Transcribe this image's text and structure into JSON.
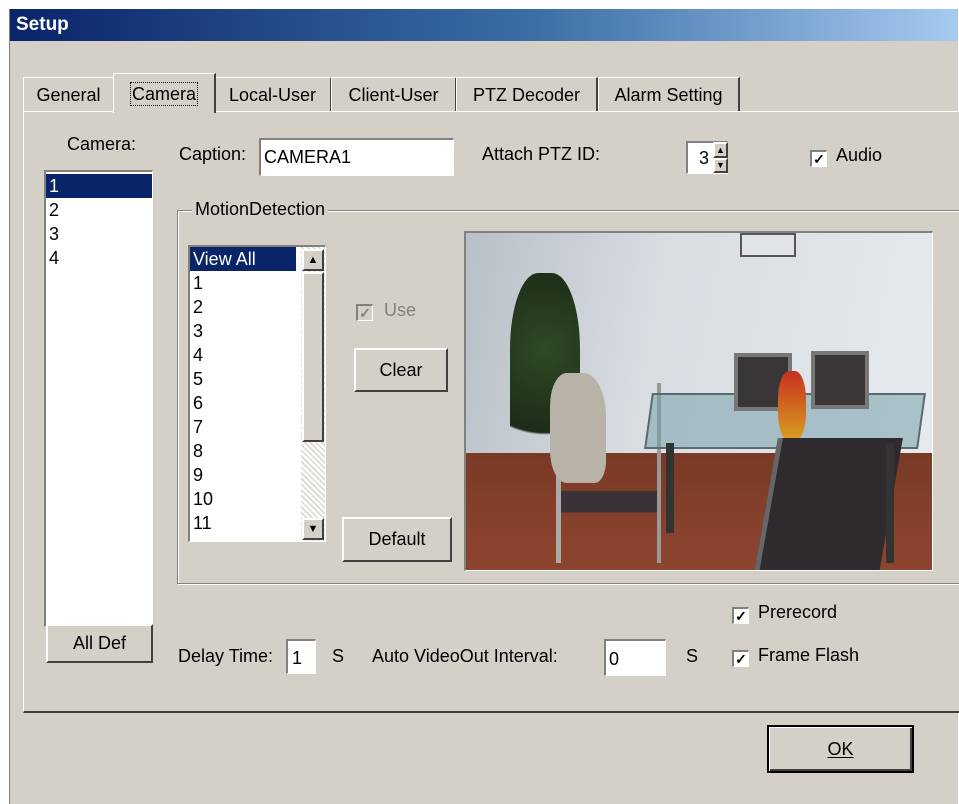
{
  "window": {
    "title": "Setup"
  },
  "tabs": [
    "General",
    "Camera",
    "Local-User",
    "Client-User",
    "PTZ Decoder",
    "Alarm Setting"
  ],
  "camera_list": {
    "label": "Camera:",
    "items": [
      "1",
      "2",
      "3",
      "4"
    ],
    "selected": "1"
  },
  "caption": {
    "label": "Caption:",
    "value": "CAMERA1"
  },
  "ptz": {
    "label": "Attach PTZ ID:",
    "value": "3"
  },
  "audio": {
    "label": "Audio",
    "checked": true
  },
  "motion": {
    "group_label": "MotionDetection",
    "items": [
      "View All",
      "1",
      "2",
      "3",
      "4",
      "5",
      "6",
      "7",
      "8",
      "9",
      "10",
      "11"
    ],
    "selected": "View All",
    "use_label": "Use",
    "clear_label": "Clear",
    "default_label": "Default"
  },
  "all_def_label": "All Def",
  "delay": {
    "label": "Delay Time:",
    "value": "1",
    "unit": "S"
  },
  "videoout": {
    "label": "Auto VideoOut Interval:",
    "value": "0",
    "unit": "S"
  },
  "prerecord": {
    "label": "Prerecord",
    "checked": true
  },
  "frame_flash": {
    "label": "Frame Flash",
    "checked": true
  },
  "ok_label": "OK"
}
